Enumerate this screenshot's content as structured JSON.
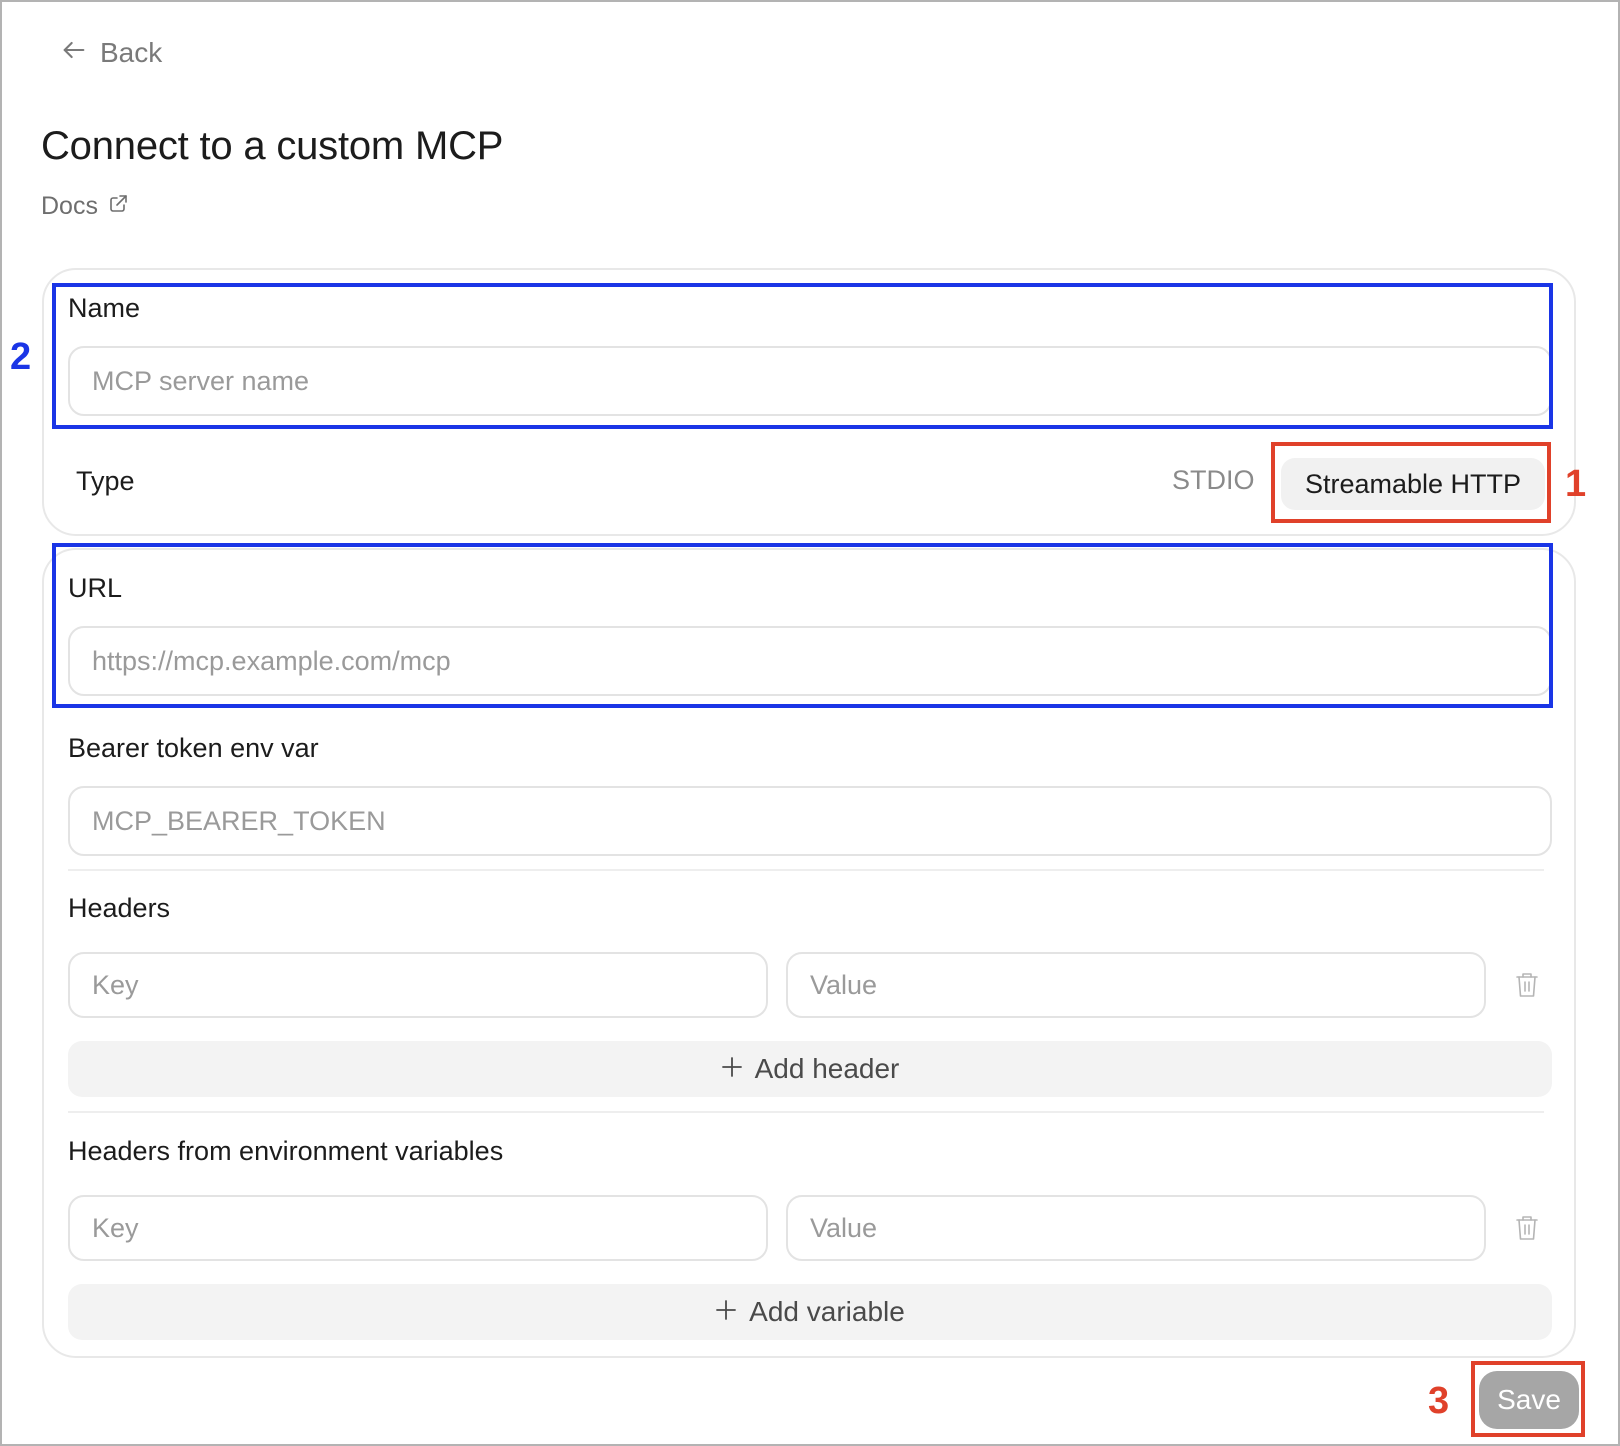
{
  "nav": {
    "back_label": "Back"
  },
  "header": {
    "title": "Connect to a custom MCP",
    "docs_label": "Docs"
  },
  "form": {
    "name": {
      "label": "Name",
      "placeholder": "MCP server name"
    },
    "type": {
      "label": "Type",
      "options": [
        "STDIO",
        "Streamable HTTP"
      ],
      "selected": "Streamable HTTP"
    },
    "url": {
      "label": "URL",
      "placeholder": "https://mcp.example.com/mcp"
    },
    "bearer": {
      "label": "Bearer token env var",
      "placeholder": "MCP_BEARER_TOKEN"
    },
    "headers": {
      "label": "Headers",
      "key_placeholder": "Key",
      "value_placeholder": "Value",
      "add_label": "Add header"
    },
    "env_headers": {
      "label": "Headers from environment variables",
      "key_placeholder": "Key",
      "value_placeholder": "Value",
      "add_label": "Add variable"
    },
    "save_label": "Save"
  },
  "annotations": {
    "one": "1",
    "two": "2",
    "three": "3"
  },
  "colors": {
    "annotation_blue": "#1a35e6",
    "annotation_red": "#e0412a",
    "save_disabled": "#a6a6a6"
  }
}
